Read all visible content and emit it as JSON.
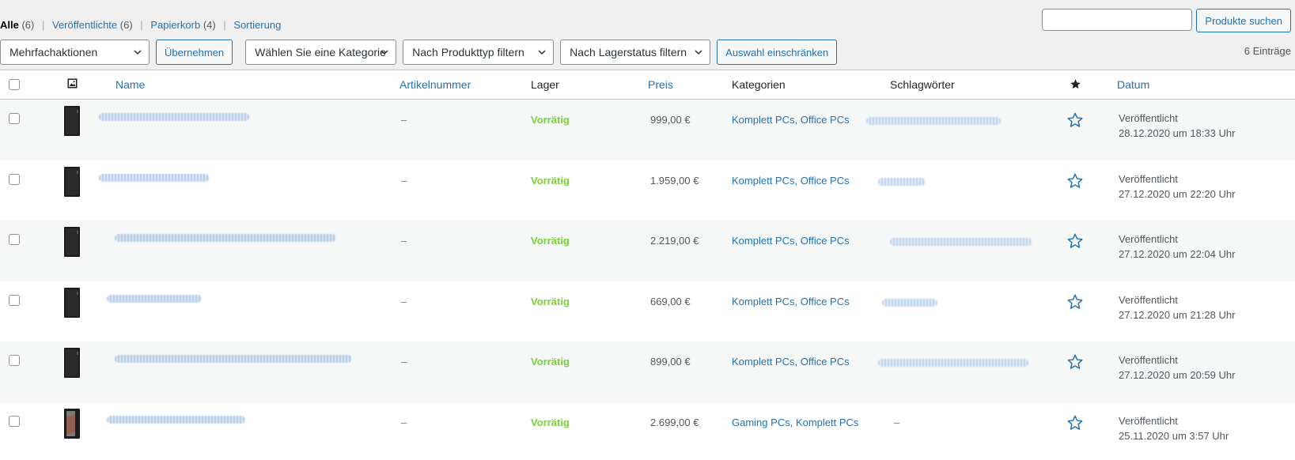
{
  "status_nav": {
    "all_label": "Alle",
    "all_count": "(6)",
    "published_label": "Veröffentlichte",
    "published_count": "(6)",
    "trash_label": "Papierkorb",
    "trash_count": "(4)",
    "sort_label": "Sortierung",
    "separator": "|"
  },
  "search": {
    "value": "",
    "button_label": "Produkte suchen"
  },
  "tablenav": {
    "bulk_actions": "Mehrfachaktionen",
    "apply_label": "Übernehmen",
    "category_filter": "Wählen Sie eine Kategorie",
    "type_filter": "Nach Produkttyp filtern",
    "stock_filter": "Nach Lagerstatus filtern",
    "filter_button": "Auswahl einschränken",
    "displaying": "6 Einträge"
  },
  "columns": {
    "name": "Name",
    "sku": "Artikelnummer",
    "stock": "Lager",
    "price": "Preis",
    "categories": "Kategorien",
    "tags": "Schlagwörter",
    "date": "Datum"
  },
  "icons": {
    "thumbnail_header": "image-icon",
    "featured_header": "star-filled-icon",
    "featured_row": "star-outline-icon",
    "dropdown": "chevron-down-icon"
  },
  "colors": {
    "link": "#2271b1",
    "in_stock": "#7ad03a"
  },
  "products": [
    {
      "sku": "–",
      "stock": "Vorrätig",
      "price": "999,00 €",
      "categories": [
        "Komplett PCs",
        "Office PCs"
      ],
      "tags": "",
      "date_status": "Veröffentlicht",
      "date": "28.12.2020 um 18:33 Uhr"
    },
    {
      "sku": "–",
      "stock": "Vorrätig",
      "price": "1.959,00 €",
      "categories": [
        "Komplett PCs",
        "Office PCs"
      ],
      "tags": "",
      "date_status": "Veröffentlicht",
      "date": "27.12.2020 um 22:20 Uhr"
    },
    {
      "sku": "–",
      "stock": "Vorrätig",
      "price": "2.219,00 €",
      "categories": [
        "Komplett PCs",
        "Office PCs"
      ],
      "tags": "",
      "date_status": "Veröffentlicht",
      "date": "27.12.2020 um 22:04 Uhr"
    },
    {
      "sku": "–",
      "stock": "Vorrätig",
      "price": "669,00 €",
      "categories": [
        "Komplett PCs",
        "Office PCs"
      ],
      "tags": "",
      "date_status": "Veröffentlicht",
      "date": "27.12.2020 um 21:28 Uhr"
    },
    {
      "sku": "–",
      "stock": "Vorrätig",
      "price": "899,00 €",
      "categories": [
        "Komplett PCs",
        "Office PCs"
      ],
      "tags": "",
      "date_status": "Veröffentlicht",
      "date": "27.12.2020 um 20:59 Uhr"
    },
    {
      "sku": "–",
      "stock": "Vorrätig",
      "price": "2.699,00 €",
      "categories": [
        "Gaming PCs",
        "Komplett PCs"
      ],
      "tags": "–",
      "date_status": "Veröffentlicht",
      "date": "25.11.2020 um 3:57 Uhr"
    }
  ]
}
